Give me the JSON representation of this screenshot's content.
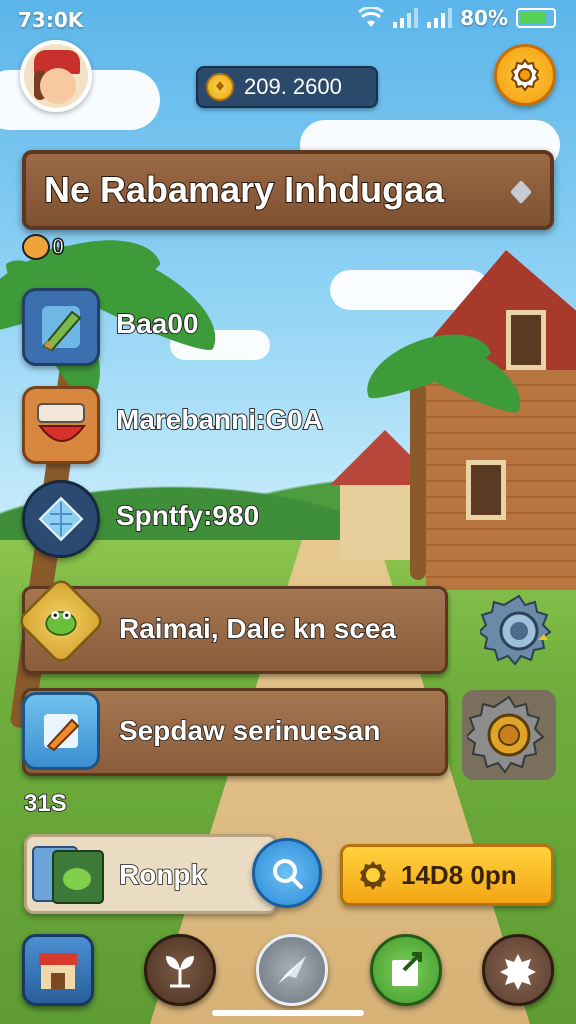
{
  "status_bar": {
    "time": "73:0K",
    "battery_pct": "80%",
    "battery_level": 0.8
  },
  "header": {
    "currency_value": "209. 2600"
  },
  "banner": {
    "title": "Ne Rabamary Inhdugaa"
  },
  "level_label": "0",
  "stats": [
    {
      "icon": "crayon-icon",
      "label": "Baa00"
    },
    {
      "icon": "red-item-icon",
      "label": "Marebanni:G0A"
    },
    {
      "icon": "crystal-icon",
      "label": "Spntfy:980"
    }
  ],
  "quests": [
    {
      "icon": "frog-icon",
      "label": "Raimai, Dale kn scea"
    },
    {
      "icon": "pencil-icon",
      "label": "Sepdaw serinuesan"
    }
  ],
  "section_count": "31S",
  "shop": {
    "label": "Ronpk",
    "reward_label": "14D8 0pn"
  },
  "nav": {
    "items": [
      "shop-icon",
      "sprout-icon",
      "compass-icon",
      "export-icon",
      "splat-icon"
    ]
  },
  "colors": {
    "accent_orange": "#f29c10",
    "panel_brown": "#8a5c3b",
    "nav_blue": "#2a88d6"
  }
}
